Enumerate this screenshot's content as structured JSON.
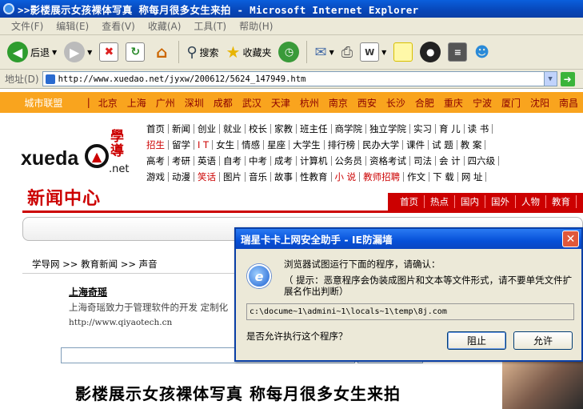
{
  "window": {
    "title": ">>影楼展示女孩裸体写真 称每月很多女生来拍 - Microsoft Internet Explorer"
  },
  "menu": [
    "文件(F)",
    "编辑(E)",
    "查看(V)",
    "收藏(A)",
    "工具(T)",
    "帮助(H)"
  ],
  "toolbar": {
    "back": "后退",
    "search": "搜索",
    "favorites": "收藏夹"
  },
  "address": {
    "label": "地址(D)",
    "url": "http://www.xuedao.net/jyxw/200612/5624_147949.htm"
  },
  "citybar": {
    "title": "城市联盟",
    "cities": [
      "北京",
      "上海",
      "广州",
      "深圳",
      "成都",
      "武汉",
      "天津",
      "杭州",
      "南京",
      "西安",
      "长沙",
      "合肥",
      "重庆",
      "宁波",
      "厦门",
      "沈阳",
      "南昌"
    ]
  },
  "site": {
    "logo_text": "xueda",
    "logo_sub": ".net",
    "logo_cn": "學導",
    "nav_rows": [
      [
        "首页",
        "新闻",
        "创业",
        "就业",
        "校长",
        "家教",
        "班主任",
        "商学院",
        "独立学院",
        "实习",
        "育 儿",
        "读 书"
      ],
      [
        "招生",
        "留学",
        "I T",
        "女生",
        "情感",
        "星座",
        "大学生",
        "排行榜",
        "民办大学",
        "课件",
        "试 题",
        "教 案"
      ],
      [
        "高考",
        "考研",
        "英语",
        "自考",
        "中考",
        "成考",
        "计算机",
        "公务员",
        "资格考试",
        "司法",
        "会 计",
        "四六级"
      ],
      [
        "游戏",
        "动漫",
        "笑话",
        "图片",
        "音乐",
        "故事",
        "性教育",
        "小 说",
        "教师招聘",
        "作文",
        "下 载",
        "网 址"
      ]
    ],
    "news_title": "新闻中心",
    "news_tabs": [
      "首页",
      "热点",
      "国内",
      "国外",
      "人物",
      "教育"
    ],
    "breadcrumb": "学导网 >> 教育新闻 >> 声音",
    "ad_title": "上海奇瑶",
    "ad_desc": "上海奇瑶致力于管理软件的开发 定制化",
    "ad_url": "http://www.qiyaotech.cn",
    "headline": "影楼展示女孩裸体写真 称每月很多女生来拍"
  },
  "dialog": {
    "title": "瑞星卡卡上网安全助手 - IE防漏墙",
    "message": "浏览器试图运行下面的程序，请确认：",
    "hint": "（ 提示：恶意程序会伪装成图片和文本等文件形式，请不要单凭文件扩展名作出判断）",
    "path": "c:\\docume~1\\admini~1\\locals~1\\temp\\8j.com",
    "question": "是否允许执行这个程序？",
    "block_label": "阻止",
    "allow_label": "允许"
  }
}
